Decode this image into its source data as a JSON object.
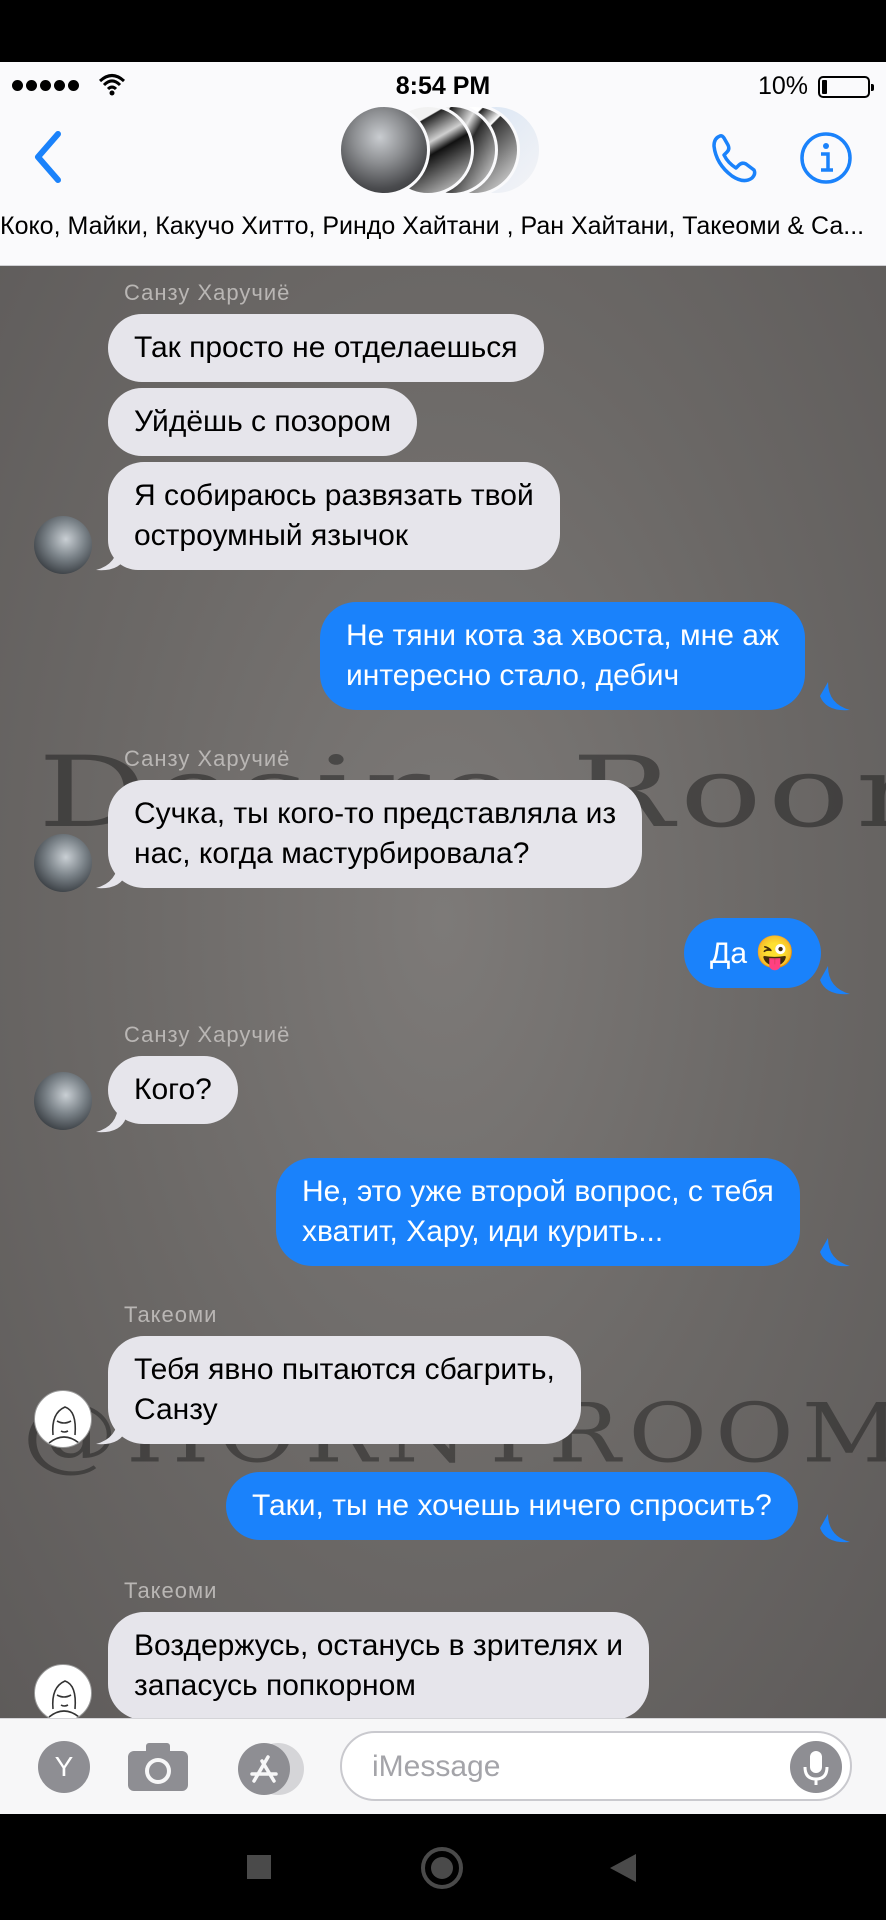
{
  "status": {
    "time": "8:54 PM",
    "battery": "10%"
  },
  "header": {
    "group_names": "Коко, Майки, Какучо Хитто, Риндо Хайтани , Ран Хайтани, Такеоми & Са..."
  },
  "messages": [
    {
      "sender": "Санзу Харучиё",
      "text": "Так просто не отделаешься"
    },
    {
      "text": "Уйдёшь с позором"
    },
    {
      "text": "Я собираюсь развязать твой острoумный язычок",
      "line1": "Я собираюсь развязать твой",
      "line2": "остроумный язычок"
    },
    {
      "line1": "Не тяни кота за хвоста, мне аж",
      "line2": "интересно стало, дебич"
    },
    {
      "sender": "Санзу Харучиё",
      "line1": "Сучка, ты кого-то представляла из",
      "line2": "нас, когда мастурбировала?"
    },
    {
      "text": "Да",
      "emoji": "😜"
    },
    {
      "sender": "Санзу Харучиё",
      "text": "Кого?"
    },
    {
      "line1": "Не, это уже второй вопрос, с тебя",
      "line2": "хватит, Хару, иди курить..."
    },
    {
      "sender": "Такеоми",
      "line1": "Тебя явно пытаются сбагрить,",
      "line2": "Санзу"
    },
    {
      "text": "Таки, ты не хочешь ничего спросить?"
    },
    {
      "sender": "Такеоми",
      "line1": "Воздержусь, останусь в зрителях и",
      "line2": "запасусь попкорном"
    }
  ],
  "watermarks": {
    "top": "Desire Room",
    "bottom": "@HORNYROOM"
  },
  "composer": {
    "placeholder": "iMessage",
    "app_label": "Y"
  },
  "colors": {
    "outgoing": "#1a82fb",
    "incoming": "#e6e5eb",
    "ios_blue": "#1a82fb"
  },
  "icons": [
    "back-chevron-icon",
    "phone-icon",
    "info-icon",
    "camera-icon",
    "app-store-icon",
    "microphone-icon",
    "nav-square-icon",
    "nav-circle-icon",
    "nav-back-icon"
  ]
}
